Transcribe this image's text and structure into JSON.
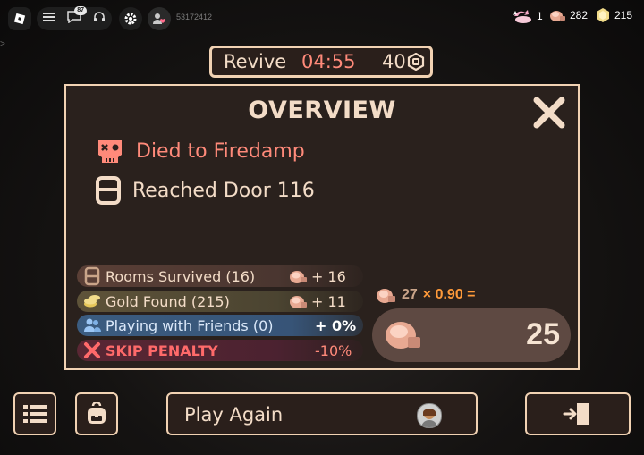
{
  "topbar": {
    "chat_badge": "87",
    "user_id": "53172412"
  },
  "currencies": {
    "revives": "1",
    "knobs": "282",
    "gold": "215"
  },
  "revive_bar": {
    "label": "Revive",
    "timer": "04:55",
    "cost": "40"
  },
  "overview": {
    "title": "OVERVIEW",
    "death": "Died to Firedamp",
    "door": "Reached Door 116",
    "rows": [
      {
        "label": "Rooms Survived (16)",
        "value": "+ 16"
      },
      {
        "label": "Gold Found (215)",
        "value": "+ 11"
      },
      {
        "label": "Playing with Friends (0)",
        "value": "+ 0%"
      },
      {
        "label": "SKIP PENALTY",
        "value": "-10%"
      }
    ],
    "multiplier": {
      "base": "27",
      "times": "× 0.90 =",
      "total": "25"
    }
  },
  "bottom": {
    "play_again": "Play Again"
  },
  "colors": {
    "accent_border": "#f1d2b3",
    "panel_bg": "#2a211d",
    "death_red": "#ff8a7a",
    "friends_blue": "#375477",
    "penalty_red": "#ff6a6a"
  }
}
